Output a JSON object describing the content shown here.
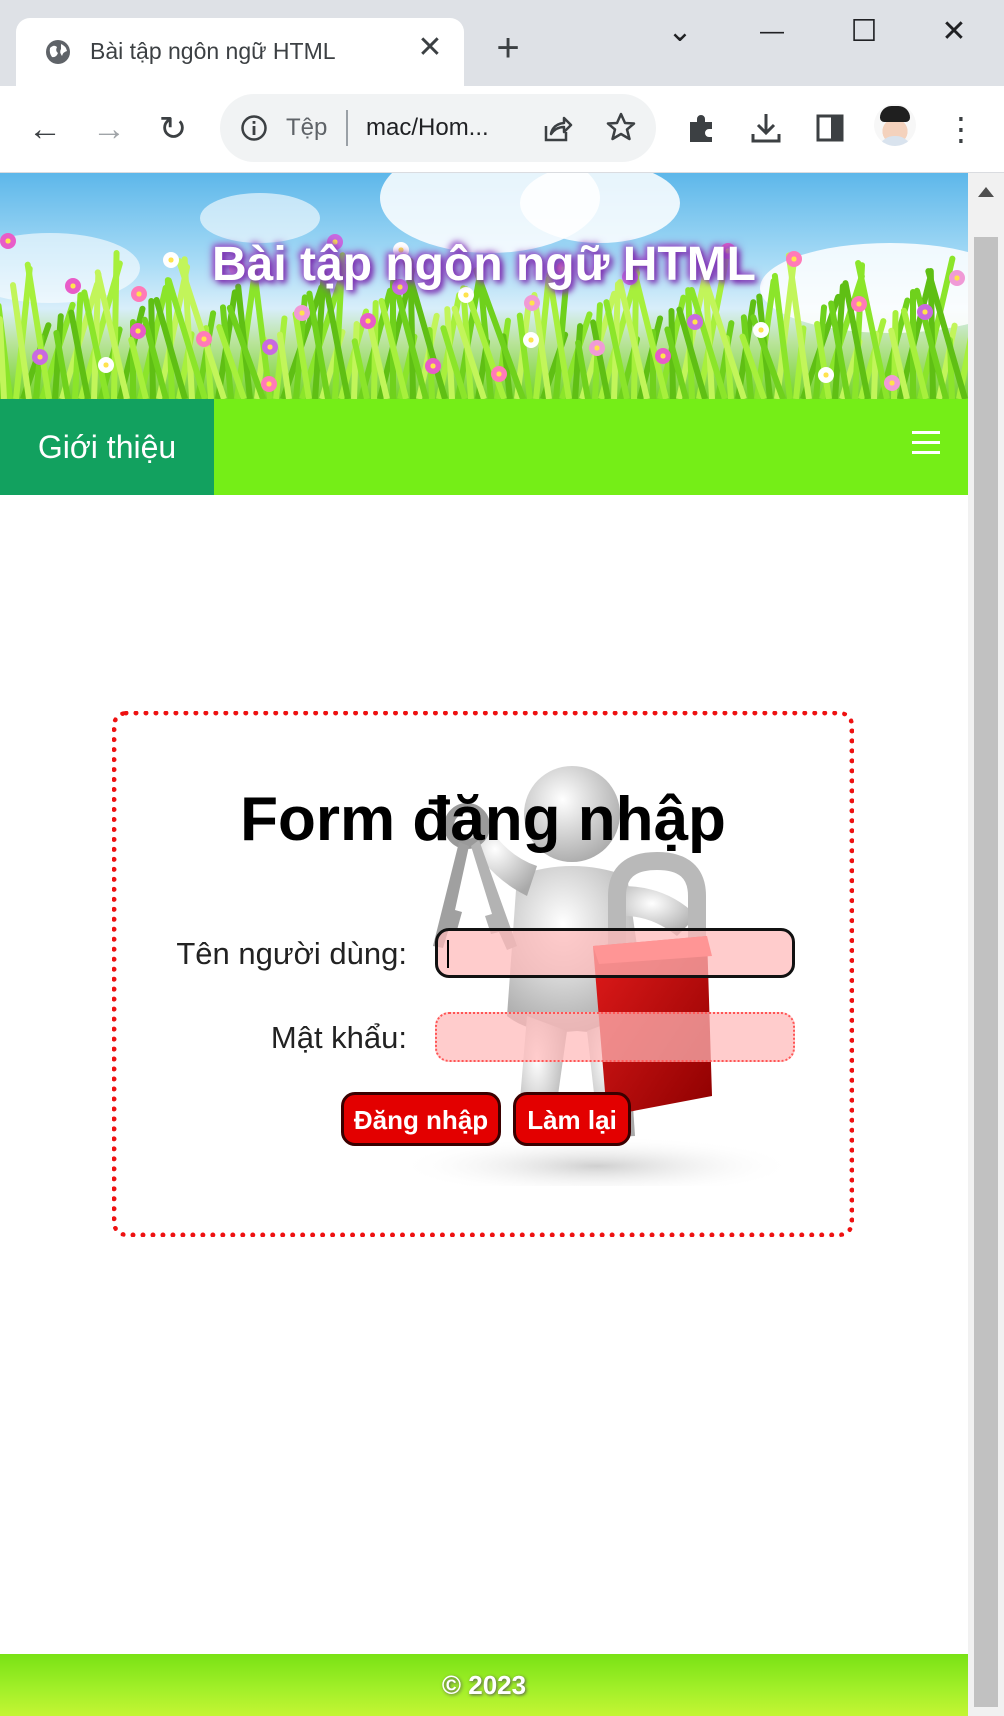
{
  "browser": {
    "tab_title": "Bài tập ngôn ngữ HTML",
    "tab_close": "✕",
    "new_tab": "+",
    "window_menu": "⌄",
    "minimize": "—",
    "maximize": "☐",
    "close": "✕",
    "back": "←",
    "forward": "→",
    "reload": "↻",
    "address_scheme": "Tệp",
    "address_url": "mac/Hom...",
    "menu": "⋮"
  },
  "site": {
    "title": "Bài tập ngôn ngữ HTML"
  },
  "nav": {
    "items": [
      {
        "label": "Giới thiệu"
      }
    ],
    "hamburger_icon": "hamburger-menu-icon"
  },
  "login_form": {
    "title": "Form đăng nhập",
    "username_label": "Tên người dùng:",
    "username_value": "",
    "password_label": "Mật khẩu:",
    "password_value": "",
    "login_button": "Đăng nhập",
    "reset_button": "Làm lại"
  },
  "footer": {
    "text": "© 2023"
  },
  "colors": {
    "menubar": "#75ee17",
    "menu_active": "#12a15f",
    "form_border": "#ee1111",
    "button": "#e30000",
    "field_fill": "#ffb8b8"
  }
}
